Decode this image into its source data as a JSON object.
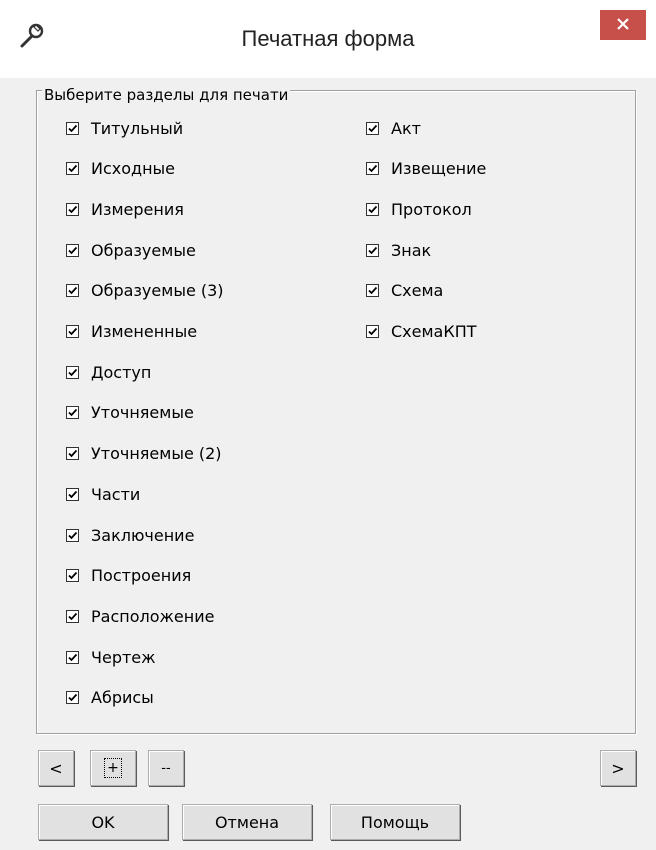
{
  "window": {
    "title": "Печатная форма",
    "icon": "wrench-icon",
    "close_icon": "close-icon",
    "close_color": "#c7504a"
  },
  "group": {
    "legend": "Выберите разделы для печати"
  },
  "left_items": [
    {
      "label": "Титульный",
      "checked": true
    },
    {
      "label": "Исходные",
      "checked": true
    },
    {
      "label": "Измерения",
      "checked": true
    },
    {
      "label": "Образуемые",
      "checked": true
    },
    {
      "label": "Образуемые (3)",
      "checked": true
    },
    {
      "label": "Измененные",
      "checked": true
    },
    {
      "label": "Доступ",
      "checked": true
    },
    {
      "label": "Уточняемые",
      "checked": true
    },
    {
      "label": "Уточняемые (2)",
      "checked": true
    },
    {
      "label": "Части",
      "checked": true
    },
    {
      "label": "Заключение",
      "checked": true
    },
    {
      "label": "Построения",
      "checked": true
    },
    {
      "label": "Расположение",
      "checked": true
    },
    {
      "label": "Чертеж",
      "checked": true
    },
    {
      "label": "Абрисы",
      "checked": true
    }
  ],
  "right_items": [
    {
      "label": "Акт",
      "checked": true
    },
    {
      "label": "Извещение",
      "checked": true
    },
    {
      "label": "Протокол",
      "checked": true
    },
    {
      "label": "Знак",
      "checked": true
    },
    {
      "label": "Схема",
      "checked": true
    },
    {
      "label": "СхемаКПТ",
      "checked": true
    }
  ],
  "nav": {
    "prev_label": "<",
    "add_label": "+",
    "remove_label": "--",
    "next_label": ">"
  },
  "footer": {
    "ok_label": "OK",
    "cancel_label": "Отмена",
    "help_label": "Помощь"
  }
}
